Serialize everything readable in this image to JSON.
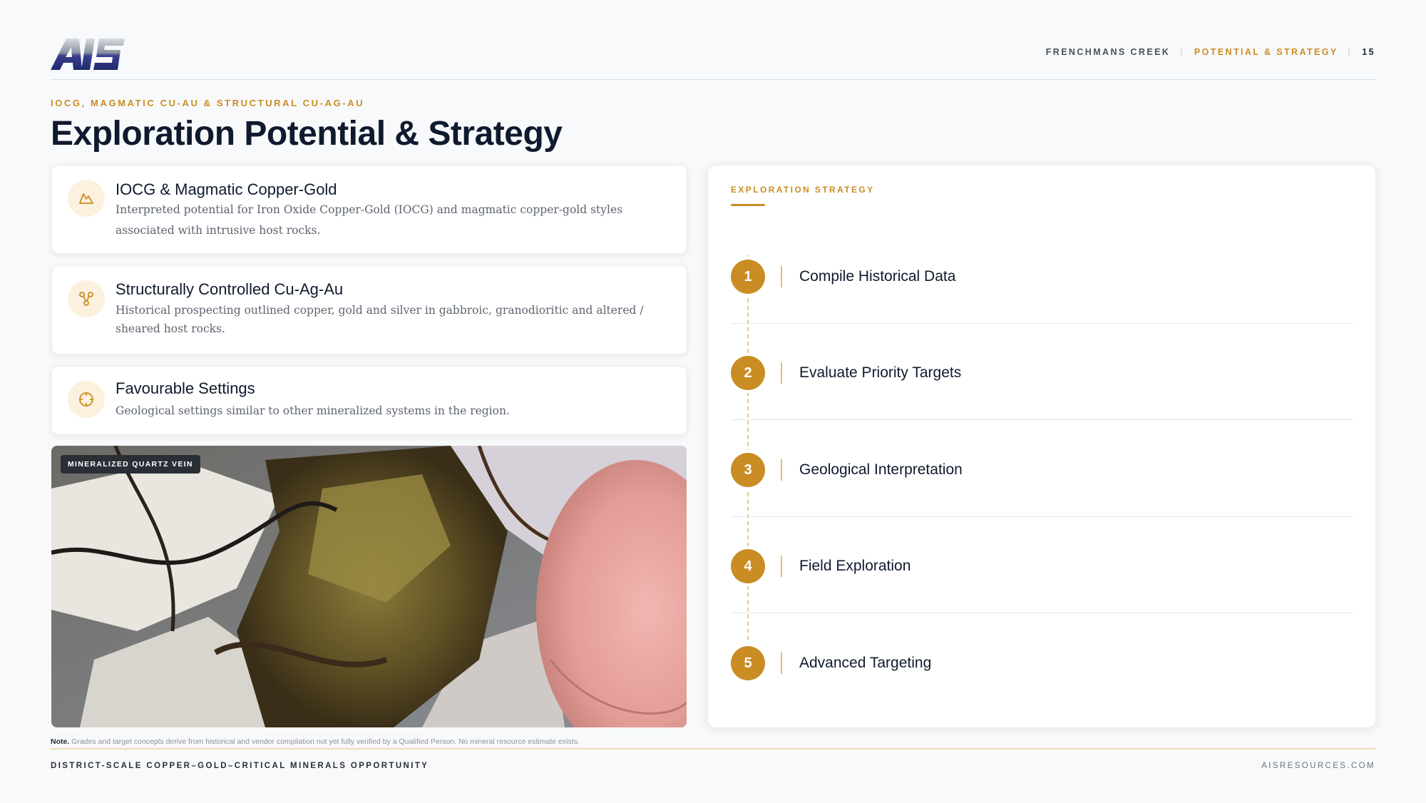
{
  "header": {
    "logo_text": "AIS",
    "nav_project": "FRENCHMANS CREEK",
    "nav_section": "POTENTIAL & STRATEGY",
    "page_number": "15"
  },
  "eyebrow": "IOCG, MAGMATIC CU-AU & STRUCTURAL CU-AG-AU",
  "title": "Exploration Potential & Strategy",
  "cards": [
    {
      "icon": "mountain-icon",
      "title": "IOCG & Magmatic Copper-Gold",
      "body": "Interpreted potential for Iron Oxide Copper-Gold (IOCG) and magmatic copper-gold styles associated with intrusive host rocks."
    },
    {
      "icon": "network-icon",
      "title": "Structurally Controlled Cu-Ag-Au",
      "body": "Historical prospecting outlined copper, gold and silver in gabbroic, granodioritic and altered / sheared host rocks."
    },
    {
      "icon": "crosshair-icon",
      "title": "Favourable Settings",
      "body": "Geological settings similar to other mineralized systems in the region."
    }
  ],
  "photo": {
    "badge": "MINERALIZED QUARTZ VEIN"
  },
  "strategy": {
    "label": "EXPLORATION STRATEGY",
    "steps": [
      {
        "number": "1",
        "label": "Compile Historical Data"
      },
      {
        "number": "2",
        "label": "Evaluate Priority Targets"
      },
      {
        "number": "3",
        "label": "Geological Interpretation"
      },
      {
        "number": "4",
        "label": "Field Exploration"
      },
      {
        "number": "5",
        "label": "Advanced Targeting"
      }
    ]
  },
  "note": {
    "prefix": "Note.",
    "text": "Grades and target concepts derive from historical and vendor compilation not yet fully verified by a Qualified Person. No mineral resource estimate exists."
  },
  "footer": {
    "left": "DISTRICT-SCALE COPPER–GOLD–CRITICAL MINERALS OPPORTUNITY",
    "right": "AISRESOURCES.COM"
  },
  "colors": {
    "accent": "#c98d23",
    "title": "#0f1a2e",
    "background": "#f8f9fa"
  }
}
